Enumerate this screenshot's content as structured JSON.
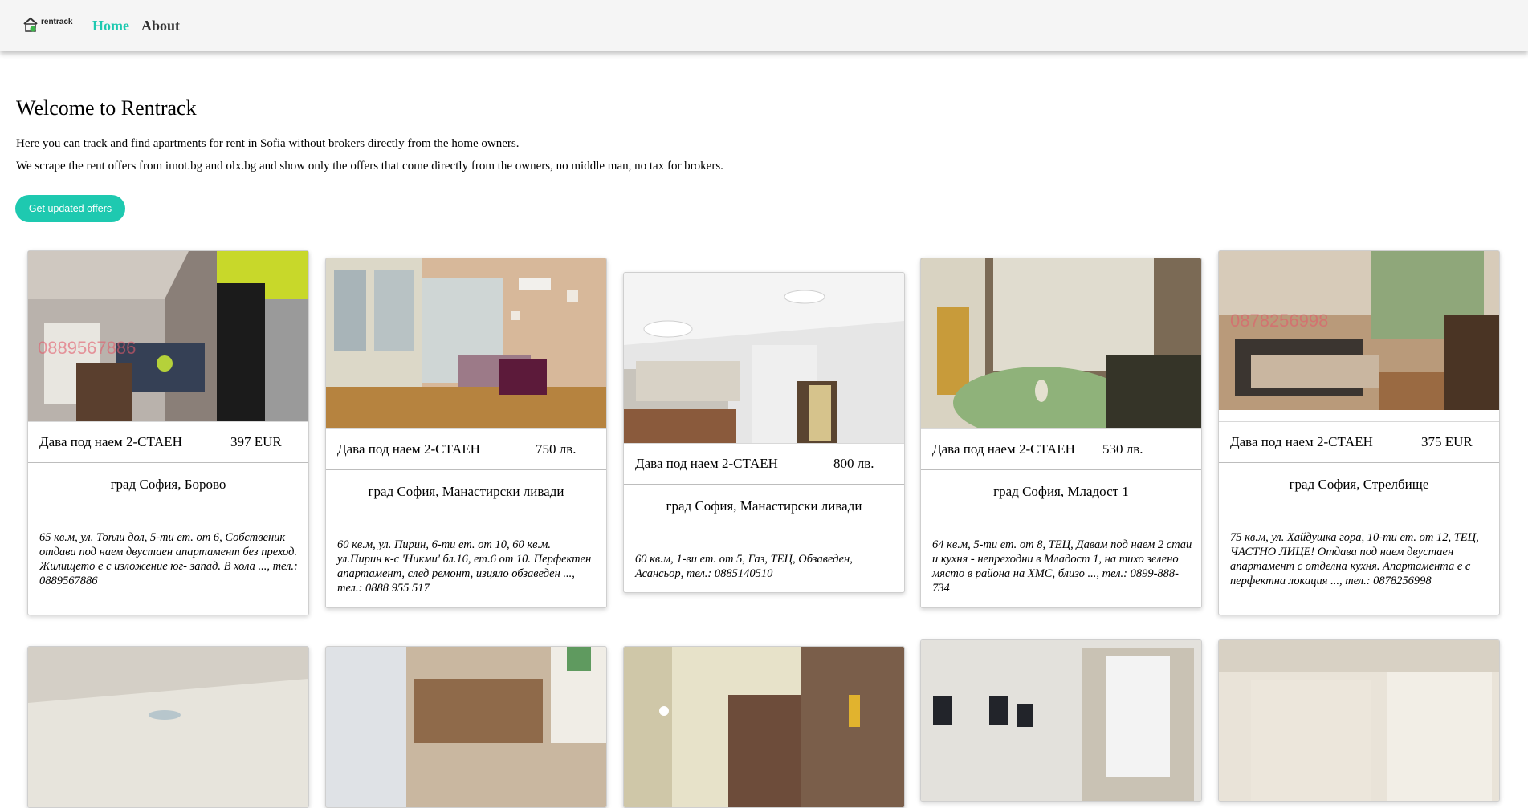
{
  "nav": {
    "logo_text": "rentrack",
    "home_label": "Home",
    "about_label": "About",
    "active": "Home",
    "accent_color": "#1ec9b0"
  },
  "intro": {
    "title": "Welcome to Rentrack",
    "line1": "Here you can track and find apartments for rent in Sofia without brokers directly from the home owners.",
    "line2": "We scrape the rent offers from imot.bg and olx.bg and show only the offers that come directly from the owners, no middle man, no tax for brokers.",
    "button_label": "Get updated offers"
  },
  "offers": [
    {
      "title": "Дава под наем 2-СТАЕН",
      "price": "397 EUR",
      "location": "град София, Борово",
      "description": "65 кв.м, ул. Топли дол, 5-ти ет. от 6, Собственик отдава под наем двустаен апартамент без преход. Жилището е с изложение юг- запад. В хола ..., тел.: 0889567886",
      "watermark": "0889567886"
    },
    {
      "title": "Дава под наем 2-СТАЕН",
      "price": "750 лв.",
      "location": "град София, Манастирски ливади",
      "description": "60 кв.м, ул. Пирин, 6-ти ет. от 10, 60 кв.м. ул.Пирин к-с 'Никми' бл.16, ет.6 от 10. Перфектен апартамент, след ремонт, изцяло обзаведен ..., тел.: 0888 955 517"
    },
    {
      "title": "Дава под наем 2-СТАЕН",
      "price": "800 лв.",
      "location": "град София, Манастирски ливади",
      "description": "60 кв.м, 1-ви ет. от 5, Газ, ТЕЦ, Обзаведен, Асансьор, тел.: 0885140510"
    },
    {
      "title": "Дава под наем 2-СТАЕН",
      "price": "530 лв.",
      "location": "град София, Младост 1",
      "description": "64 кв.м, 5-ти ет. от 8, ТЕЦ, Давам под наем 2 стаи и кухня - непреходни в Младост 1, на тихо зелено място в района на ХМС, близо ..., тел.: 0899-888-734"
    },
    {
      "title": "Дава под наем 2-СТАЕН",
      "price": "375 EUR",
      "location": "град София, Стрелбище",
      "description": "75 кв.м, ул. Хайдушка гора, 10-ти ет. от 12, ТЕЦ, ЧАСТНО ЛИЦЕ! Отдава под наем двустаен апартамент с отделна кухня. Апартамента е с перфектна локация ..., тел.: 0878256998",
      "watermark": "0878256998"
    }
  ]
}
